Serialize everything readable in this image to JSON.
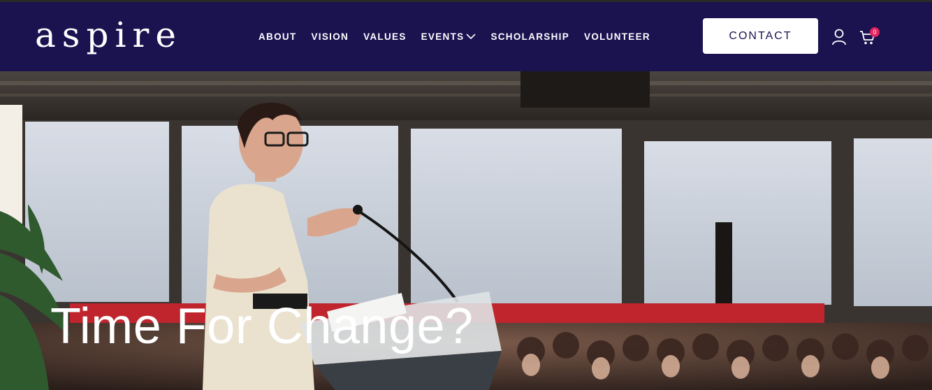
{
  "brand": {
    "logo_text": "aspire"
  },
  "nav": {
    "items": [
      {
        "label": "ABOUT"
      },
      {
        "label": "VISION"
      },
      {
        "label": "VALUES"
      },
      {
        "label": "EVENTS",
        "has_dropdown": true
      },
      {
        "label": "SCHOLARSHIP"
      },
      {
        "label": "VOLUNTEER"
      }
    ]
  },
  "header": {
    "contact_label": "CONTACT",
    "cart_count": "0",
    "icons": [
      "user-icon",
      "cart-icon",
      "chevron-down-icon"
    ]
  },
  "hero": {
    "title": "Time For Change?",
    "subtitle_partial": "",
    "image_desc_icon": "speaker-photo"
  },
  "colors": {
    "header_bg": "#1b1250",
    "button_bg": "#ffffff",
    "button_text": "#1b1250",
    "badge": "#e0245e",
    "text": "#ffffff"
  }
}
